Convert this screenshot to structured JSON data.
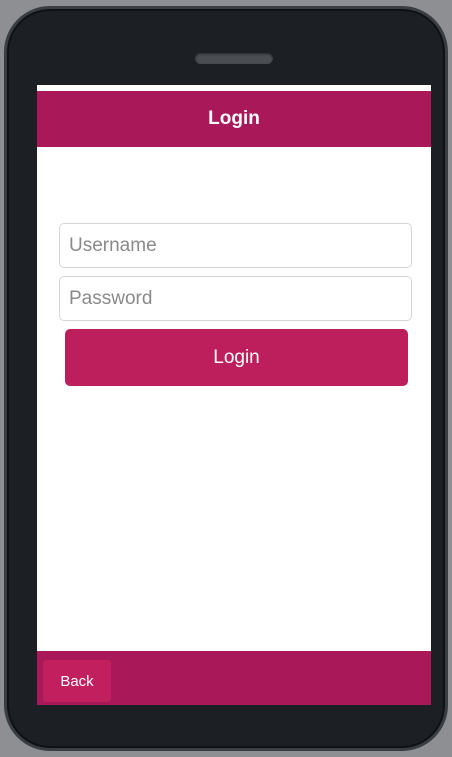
{
  "header": {
    "title": "Login"
  },
  "form": {
    "username": {
      "value": "",
      "placeholder": "Username"
    },
    "password": {
      "value": "",
      "placeholder": "Password"
    },
    "login_label": "Login"
  },
  "footer": {
    "back_label": "Back"
  },
  "colors": {
    "brand": "#a9195a",
    "button": "#bd1f5c",
    "device": "#1c1f23"
  }
}
